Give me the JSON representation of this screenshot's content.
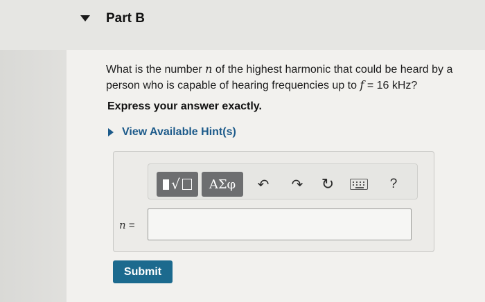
{
  "part": {
    "title": "Part B"
  },
  "question": {
    "text_1": "What is the number ",
    "var_n": "n",
    "text_2": " of the highest harmonic that could be heard by a person who is capable of hearing frequencies up to ",
    "var_f": "f",
    "text_3": " = 16 kHz?"
  },
  "instruction": "Express your answer exactly.",
  "hint": {
    "label": "View Available Hint(s)"
  },
  "toolbar": {
    "templates_icon": "templates-radical-icon",
    "greek_label": "ΑΣφ",
    "undo_icon": "undo-arrow-icon",
    "undo_glyph": "↶",
    "redo_icon": "redo-arrow-icon",
    "redo_glyph": "↷",
    "reset_icon": "reset-icon",
    "reset_glyph": "↻",
    "keyboard_icon": "keyboard-icon",
    "help_label": "?"
  },
  "answer": {
    "var_label": "n =",
    "value": ""
  },
  "submit_label": "Submit",
  "colors": {
    "link": "#1c5a8a",
    "submit": "#1c6a8e",
    "toolbar_button": "#6d6e70"
  }
}
